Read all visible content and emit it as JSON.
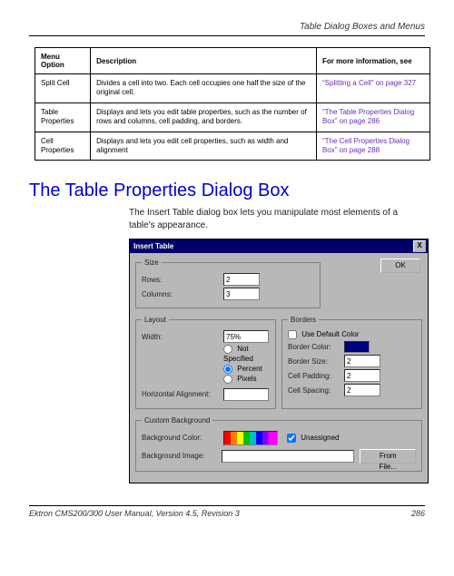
{
  "header": {
    "title": "Table Dialog Boxes and Menus"
  },
  "table": {
    "headers": {
      "option": "Menu Option",
      "description": "Description",
      "more": "For more information, see"
    },
    "rows": [
      {
        "option": "Split Cell",
        "description": "Divides a cell into two. Each cell occupies one half the size of the original cell.",
        "more": "“Splitting a Cell” on page 327"
      },
      {
        "option": "Table Properties",
        "description": "Displays and lets you edit table properties, such as the number of rows and columns, cell padding, and borders.",
        "more": "“The Table Properties Dialog Box” on page 286"
      },
      {
        "option": "Cell Properties",
        "description": "Displays and lets you edit cell properties, such as width and alignment",
        "more": "“The Cell Properties Dialog Box” on page 288"
      }
    ]
  },
  "section": {
    "heading": "The Table Properties Dialog Box",
    "intro": "The Insert Table dialog box lets you manipulate most elements of a table's appearance."
  },
  "dialog": {
    "title": "Insert Table",
    "close": "X",
    "ok": "OK",
    "size": {
      "legend": "Size",
      "rows_label": "Rows:",
      "rows_value": "2",
      "cols_label": "Columns:",
      "cols_value": "3"
    },
    "layout": {
      "legend": "Layout",
      "width_label": "Width:",
      "width_value": "75%",
      "r_notspec": "Not Specified",
      "r_percent": "Percent",
      "r_pixels": "Pixels",
      "halign_label": "Horizontal Alignment:",
      "halign_value": ""
    },
    "borders": {
      "legend": "Borders",
      "use_default": "Use Default Color",
      "border_color": "Border Color:",
      "border_size": "Border Size:",
      "border_size_value": "2",
      "cell_padding": "Cell Padding:",
      "cell_padding_value": "2",
      "cell_spacing": "Cell Spacing:",
      "cell_spacing_value": "2"
    },
    "background": {
      "legend": "Custom Background",
      "bg_color_label": "Background Color:",
      "unassigned": "Unassigned",
      "bg_image_label": "Background Image:",
      "from_file": "From File..."
    }
  },
  "footer": {
    "left": "Ektron CMS200/300 User Manual, Version 4.5, Revision 3",
    "right": "286"
  }
}
